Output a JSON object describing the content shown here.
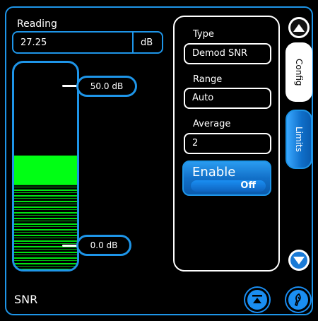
{
  "reading": {
    "label": "Reading",
    "value": "27.25",
    "unit": "dB"
  },
  "meter": {
    "upper_limit": "50.0 dB",
    "lower_limit": "0.0 dB",
    "fill_fraction": 0.55,
    "fill_color": "#00ff14"
  },
  "config": {
    "type": {
      "label": "Type",
      "value": "Demod SNR"
    },
    "range": {
      "label": "Range",
      "value": "Auto"
    },
    "average": {
      "label": "Average",
      "value": "2"
    },
    "enable": {
      "label": "Enable",
      "state": "Off"
    }
  },
  "tabs": {
    "config": "Config",
    "limits": "Limits"
  },
  "title": "SNR",
  "icons": {
    "scroll_up": "triangle-up-icon",
    "scroll_down": "triangle-down-icon",
    "collapse": "eject-icon",
    "probe": "probe-icon"
  },
  "colors": {
    "accent": "#1e95e8",
    "meter": "#00ff14"
  }
}
